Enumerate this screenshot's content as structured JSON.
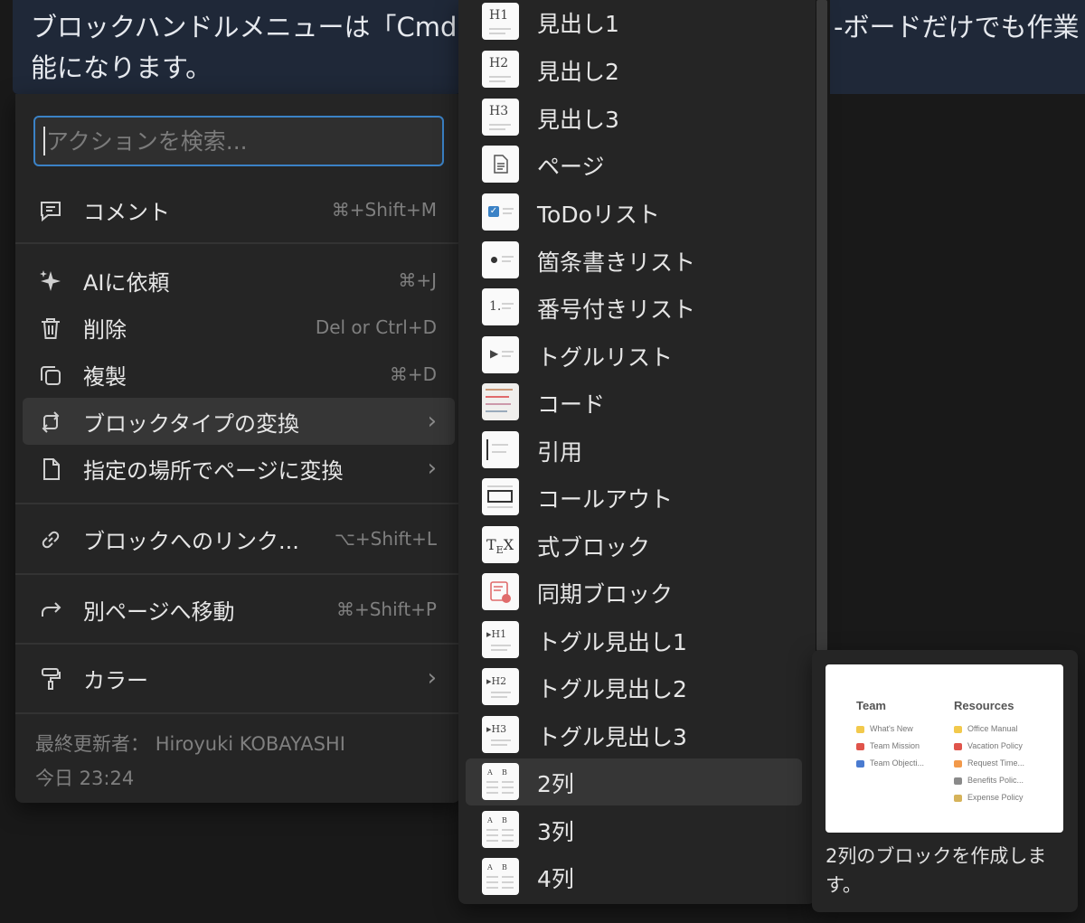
{
  "banner": {
    "left_line1": "ブロックハンドルメニューは「Cmd",
    "left_line2": "能になります。",
    "right_line1": "-ボードだけでも作業"
  },
  "menu": {
    "search_placeholder": "アクションを検索...",
    "items": [
      {
        "icon": "comment-icon",
        "label": "コメント",
        "shortcut": "⌘+Shift+M"
      },
      {
        "icon": "sparkle-icon",
        "label": "AIに依頼",
        "shortcut": "⌘+J"
      },
      {
        "icon": "trash-icon",
        "label": "削除",
        "shortcut": "Del or Ctrl+D"
      },
      {
        "icon": "duplicate-icon",
        "label": "複製",
        "shortcut": "⌘+D"
      },
      {
        "icon": "convert-icon",
        "label": "ブロックタイプの変換",
        "shortcut": ""
      },
      {
        "icon": "page-icon",
        "label": "指定の場所でページに変換",
        "shortcut": ""
      },
      {
        "icon": "link-icon",
        "label": "ブロックへのリンク...",
        "shortcut": "⌥+Shift+L"
      },
      {
        "icon": "move-arrow-icon",
        "label": "別ページへ移動",
        "shortcut": "⌘+Shift+P"
      },
      {
        "icon": "paint-roller-icon",
        "label": "カラー",
        "shortcut": ""
      }
    ],
    "last_edited_label": "最終更新者：",
    "last_edited_by": "Hiroyuki KOBAYASHI",
    "last_edited_time": "今日 23:24"
  },
  "submenu": {
    "items": [
      {
        "label": "見出し1",
        "thumb": "H1"
      },
      {
        "label": "見出し2",
        "thumb": "H2"
      },
      {
        "label": "見出し3",
        "thumb": "H3"
      },
      {
        "label": "ページ",
        "thumb": "page"
      },
      {
        "label": "ToDoリスト",
        "thumb": "todo"
      },
      {
        "label": "箇条書きリスト",
        "thumb": "bullet"
      },
      {
        "label": "番号付きリスト",
        "thumb": "number"
      },
      {
        "label": "トグルリスト",
        "thumb": "toggle"
      },
      {
        "label": "コード",
        "thumb": "code"
      },
      {
        "label": "引用",
        "thumb": "quote"
      },
      {
        "label": "コールアウト",
        "thumb": "callout"
      },
      {
        "label": "式ブロック",
        "thumb": "tex"
      },
      {
        "label": "同期ブロック",
        "thumb": "sync"
      },
      {
        "label": "トグル見出し1",
        "thumb": "▸H1"
      },
      {
        "label": "トグル見出し2",
        "thumb": "▸H2"
      },
      {
        "label": "トグル見出し3",
        "thumb": "▸H3"
      },
      {
        "label": "2列",
        "thumb": "cols"
      },
      {
        "label": "3列",
        "thumb": "cols"
      },
      {
        "label": "4列",
        "thumb": "cols"
      }
    ],
    "active_index": 16
  },
  "tooltip": {
    "preview": {
      "left_heading": "Team",
      "left_items": [
        "What's New",
        "Team Mission",
        "Team Objecti..."
      ],
      "right_heading": "Resources",
      "right_items": [
        "Office Manual",
        "Vacation Policy",
        "Request Time...",
        "Benefits Polic...",
        "Expense Policy"
      ]
    },
    "text": "2列のブロックを作成します。"
  }
}
